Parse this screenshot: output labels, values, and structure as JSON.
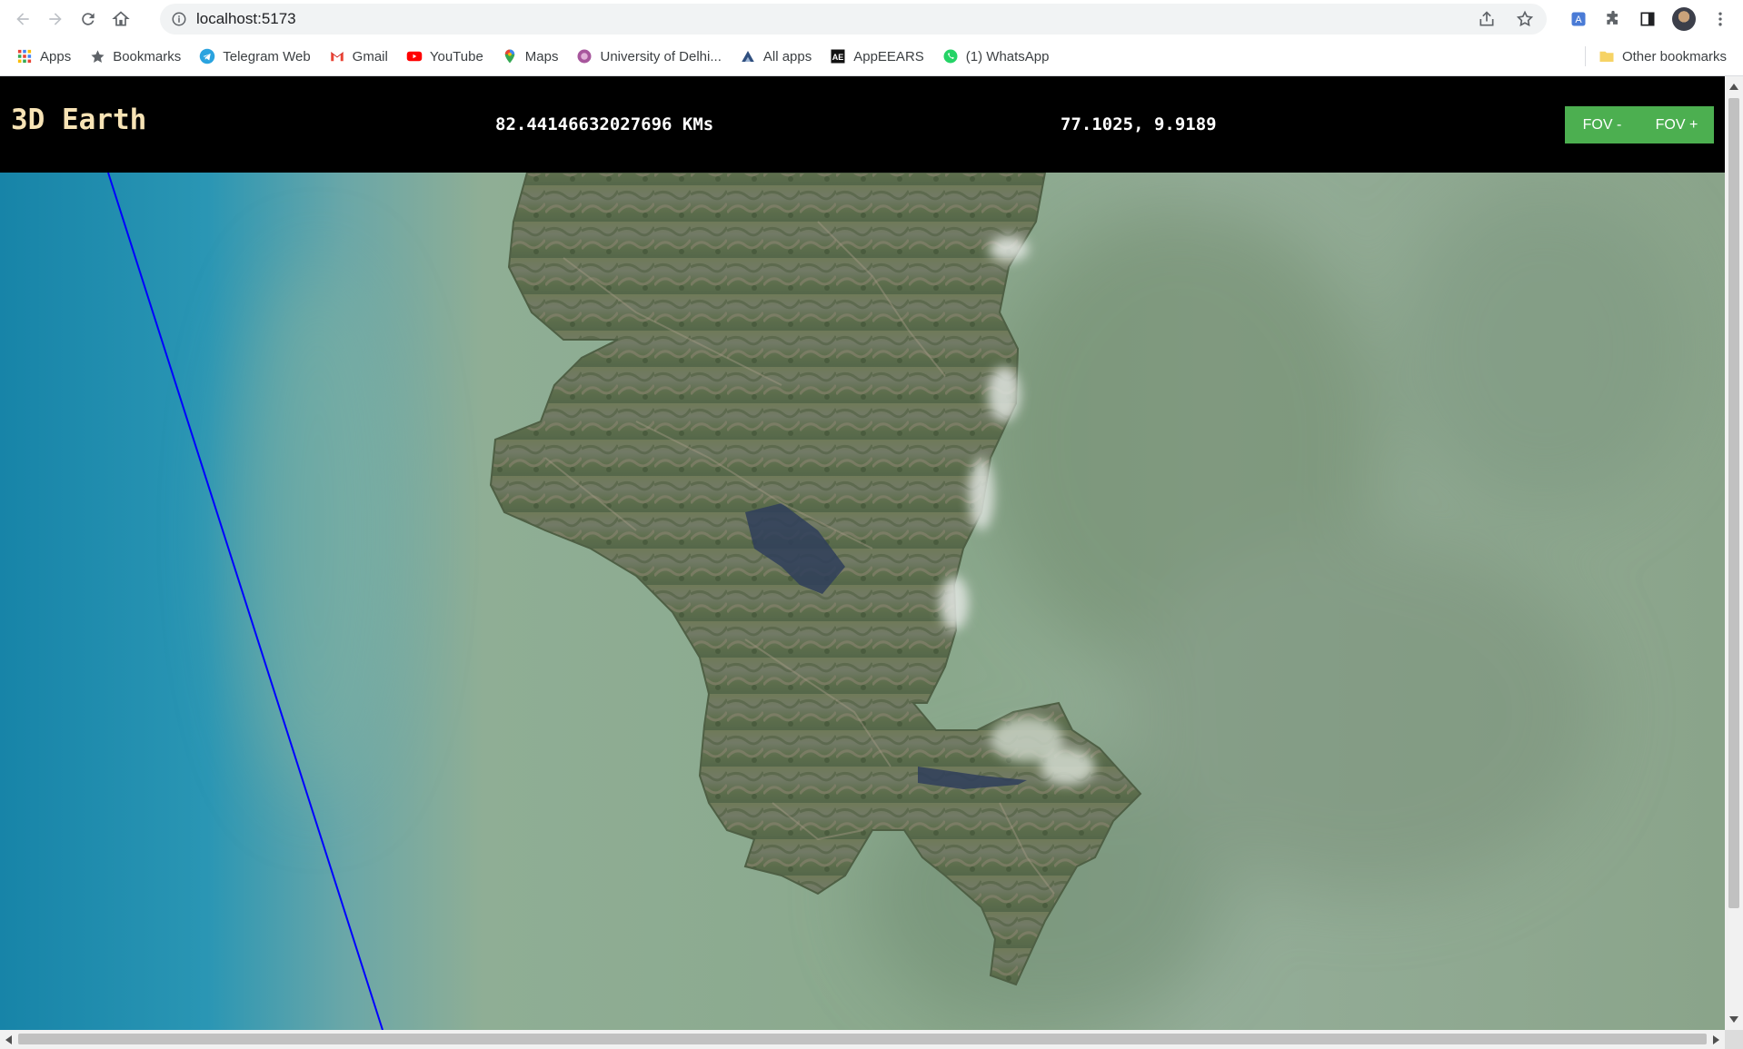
{
  "browser": {
    "url": "localhost:5173",
    "bookmarks": [
      {
        "label": "Apps",
        "icon": "apps-grid-icon"
      },
      {
        "label": "Bookmarks",
        "icon": "star-icon"
      },
      {
        "label": "Telegram Web",
        "icon": "telegram-icon"
      },
      {
        "label": "Gmail",
        "icon": "gmail-icon"
      },
      {
        "label": "YouTube",
        "icon": "youtube-icon"
      },
      {
        "label": "Maps",
        "icon": "maps-pin-icon"
      },
      {
        "label": "University of Delhi...",
        "icon": "university-icon"
      },
      {
        "label": "All apps",
        "icon": "all-apps-icon"
      },
      {
        "label": "AppEEARS",
        "icon": "appeears-icon"
      },
      {
        "label": "(1) WhatsApp",
        "icon": "whatsapp-icon"
      }
    ],
    "other_bookmarks": "Other bookmarks"
  },
  "app": {
    "title": "3D Earth",
    "distance": "82.44146632027696 KMs",
    "coordinates": "77.1025, 9.9189",
    "fov_minus": "FOV -",
    "fov_plus": "FOV +"
  },
  "colors": {
    "header_bg": "#000000",
    "title_color": "#f7e3b5",
    "fov_button": "#4caf50",
    "ocean": "#1f8fb0",
    "land_haze": "#8fa98f",
    "track_line": "#0000ff"
  }
}
